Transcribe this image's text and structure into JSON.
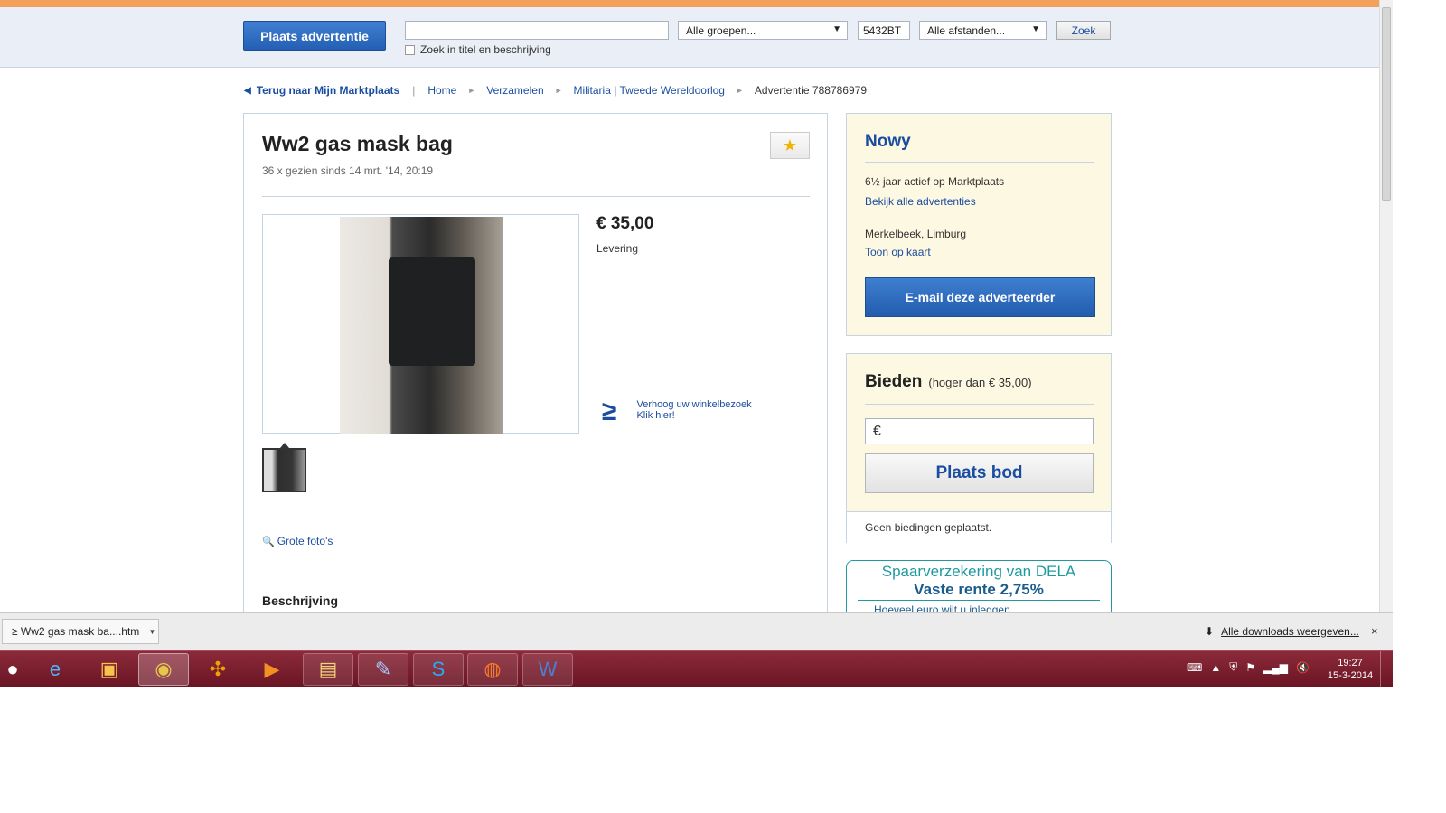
{
  "header": {
    "place_ad_label": "Plaats advertentie",
    "search_value": "",
    "group_select": "Alle groepen...",
    "postcode": "5432BT",
    "distance_select": "Alle afstanden...",
    "search_button": "Zoek",
    "title_desc_checkbox": "Zoek in titel en beschrijving"
  },
  "breadcrumb": {
    "back": "Terug naar Mijn Marktplaats",
    "items": [
      "Home",
      "Verzamelen",
      "Militaria | Tweede Wereldoorlog"
    ],
    "current": "Advertentie 788786979"
  },
  "listing": {
    "title": "Ww2 gas mask bag",
    "views": "36 x gezien sinds 14 mrt. '14, 20:19",
    "price": "€ 35,00",
    "delivery": "Levering",
    "promo_line1": "Verhoog uw winkelbezoek",
    "promo_line2": "Klik hier!",
    "large_photos": "Grote foto's",
    "description_heading": "Beschrijving"
  },
  "seller": {
    "name": "Nowy",
    "active": "6½ jaar actief op Marktplaats",
    "all_ads": "Bekijk alle advertenties",
    "location": "Merkelbeek, Limburg",
    "map": "Toon op kaart",
    "email_button": "E-mail deze adverteerder"
  },
  "bid": {
    "heading": "Bieden",
    "sub": "(hoger dan € 35,00)",
    "currency": "€",
    "button": "Plaats bod",
    "no_bids": "Geen biedingen geplaatst."
  },
  "ad": {
    "line1": "Spaarverzekering van DELA",
    "line2": "Vaste rente 2,75%",
    "line3": "Hoeveel euro wilt u inleggen"
  },
  "downloads": {
    "item": "≥ Ww2 gas mask ba....htm",
    "all": "Alle downloads weergeven...",
    "close": "×"
  },
  "taskbar": {
    "time": "19:27",
    "date": "15-3-2014",
    "icons": [
      "ie-icon",
      "app-icon",
      "chrome-icon",
      "games-icon",
      "media-icon",
      "explorer-icon",
      "pen-icon",
      "skype-icon",
      "origin-icon",
      "word-icon"
    ]
  },
  "colors": {
    "brand_blue": "#1a4d9f",
    "accent_orange": "#f3a15a",
    "taskbar": "#7a1d2e"
  }
}
